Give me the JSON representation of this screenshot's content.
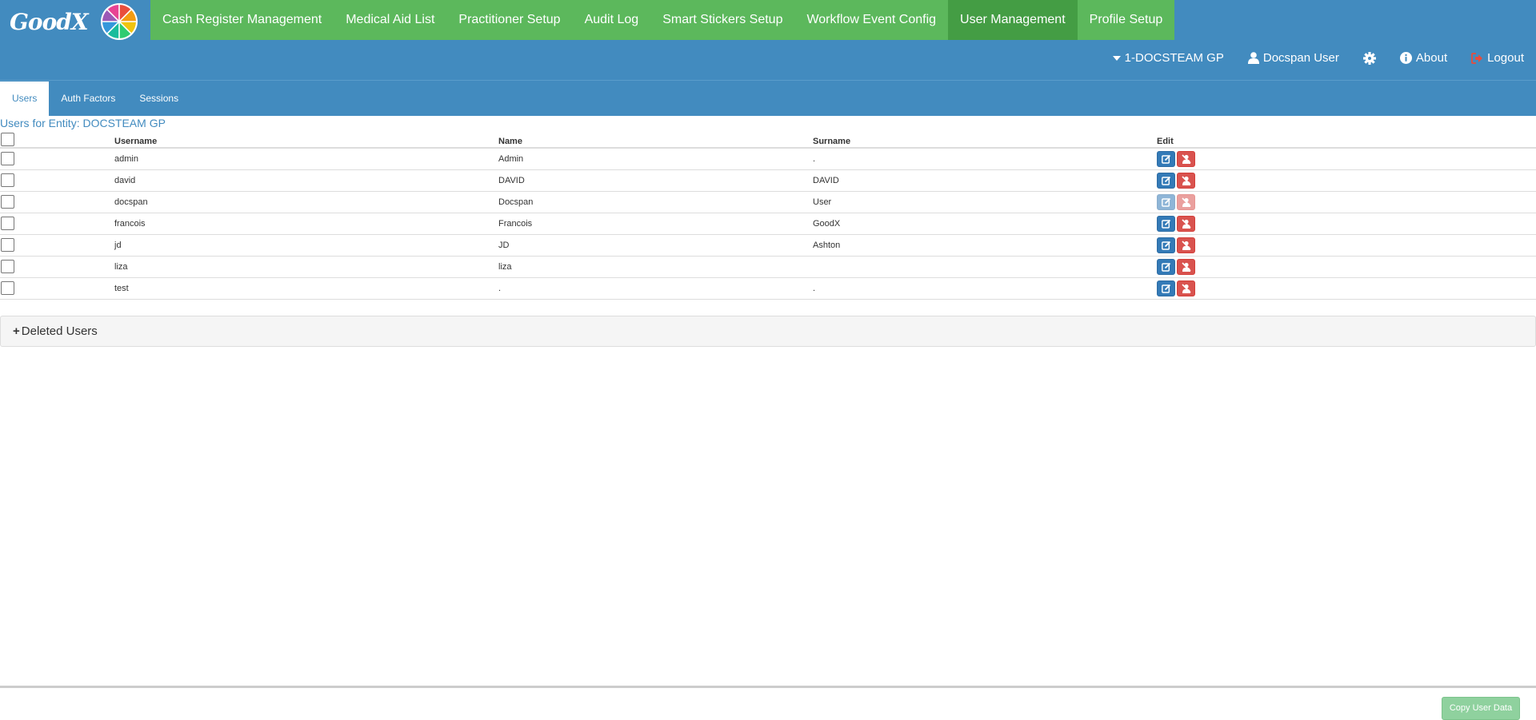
{
  "app": {
    "logo_text": "GoodX"
  },
  "topnav": {
    "items": [
      {
        "label": "Cash Register Management"
      },
      {
        "label": "Medical Aid List"
      },
      {
        "label": "Practitioner Setup"
      },
      {
        "label": "Audit Log"
      },
      {
        "label": "Smart Stickers Setup"
      },
      {
        "label": "Workflow Event Config"
      },
      {
        "label": "User Management",
        "active": true
      },
      {
        "label": "Profile Setup"
      }
    ]
  },
  "userbar": {
    "entity": "1-DOCSTEAM GP",
    "user": "Docspan User",
    "about": "About",
    "logout": "Logout"
  },
  "subtabs": {
    "items": [
      {
        "label": "Users",
        "active": true
      },
      {
        "label": "Auth Factors"
      },
      {
        "label": "Sessions"
      }
    ]
  },
  "main": {
    "entity_title": "Users for Entity: DOCSTEAM GP",
    "table": {
      "headers": {
        "username": "Username",
        "name": "Name",
        "surname": "Surname",
        "edit": "Edit"
      },
      "rows": [
        {
          "username": "admin",
          "name": "Admin",
          "surname": ".",
          "disabled": false
        },
        {
          "username": "david",
          "name": "DAVID",
          "surname": "DAVID",
          "disabled": false
        },
        {
          "username": "docspan",
          "name": "Docspan",
          "surname": "User",
          "disabled": true
        },
        {
          "username": "francois",
          "name": "Francois",
          "surname": "GoodX",
          "disabled": false
        },
        {
          "username": "jd",
          "name": "JD",
          "surname": "Ashton",
          "disabled": false
        },
        {
          "username": "liza",
          "name": "liza",
          "surname": "",
          "disabled": false
        },
        {
          "username": "test",
          "name": ".",
          "surname": ".",
          "disabled": false
        }
      ]
    },
    "deleted_users": {
      "toggle_symbol": "+",
      "label": "Deleted Users"
    }
  },
  "footer": {
    "copy_button": "Copy User Data"
  },
  "icons": {
    "entity": "caret-down-icon",
    "user": "user-icon",
    "settings": "gear-icon",
    "about": "info-circle-icon",
    "logout": "sign-out-icon",
    "edit": "edit-icon",
    "delete": "user-delete-icon"
  },
  "colors": {
    "header": "#428bbf",
    "nav_green": "#5cb85c",
    "nav_active": "#449d44",
    "edit_blue": "#337ab7",
    "delete_red": "#d9534f",
    "logout_red": "#e74c3c",
    "copy_green": "#8fd19e"
  }
}
